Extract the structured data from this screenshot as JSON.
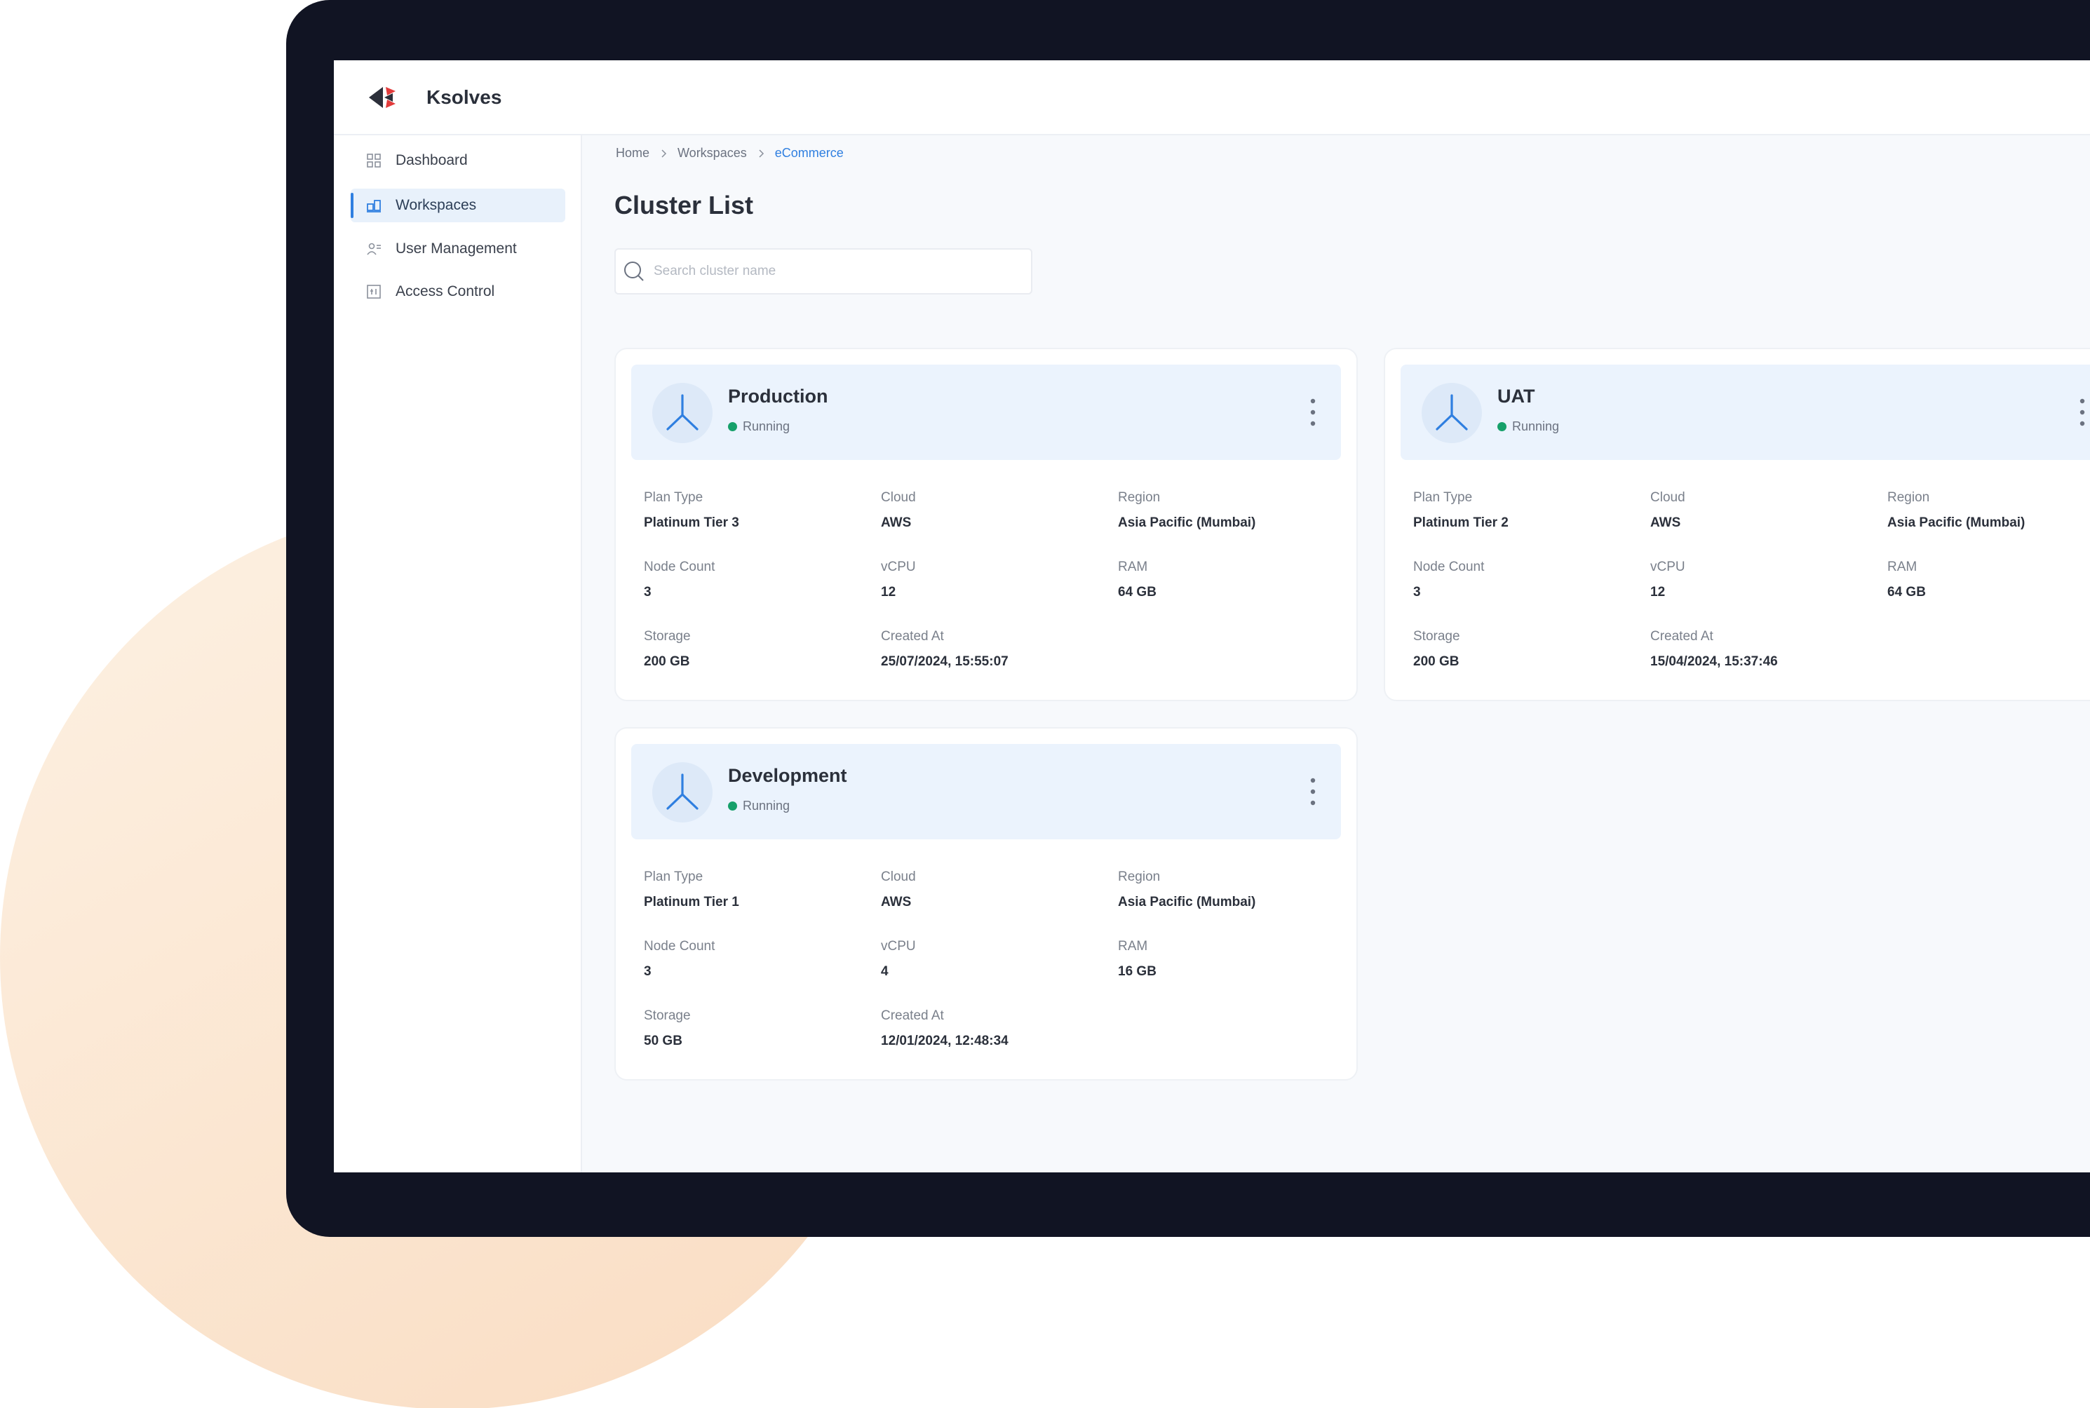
{
  "app": {
    "brand": "Ksolves"
  },
  "sidebar": {
    "items": [
      {
        "label": "Dashboard",
        "icon": "dashboard-icon",
        "active": false
      },
      {
        "label": "Workspaces",
        "icon": "workspaces-icon",
        "active": true
      },
      {
        "label": "User Management",
        "icon": "users-icon",
        "active": false
      },
      {
        "label": "Access Control",
        "icon": "access-control-icon",
        "active": false
      }
    ]
  },
  "breadcrumb": {
    "items": [
      "Home",
      "Workspaces",
      "eCommerce"
    ]
  },
  "main": {
    "title": "Cluster List",
    "search_placeholder": "Search cluster name"
  },
  "clusters": [
    {
      "name": "Production",
      "status": "Running",
      "fields": [
        {
          "label": "Plan Type",
          "value": "Platinum Tier 3"
        },
        {
          "label": "Cloud",
          "value": "AWS"
        },
        {
          "label": "Region",
          "value": "Asia Pacific (Mumbai)"
        },
        {
          "label": "Node Count",
          "value": "3"
        },
        {
          "label": "vCPU",
          "value": "12"
        },
        {
          "label": "RAM",
          "value": "64 GB"
        },
        {
          "label": "Storage",
          "value": "200 GB"
        },
        {
          "label": "Created At",
          "value": "25/07/2024, 15:55:07"
        }
      ]
    },
    {
      "name": "UAT",
      "status": "Running",
      "fields": [
        {
          "label": "Plan Type",
          "value": "Platinum Tier 2"
        },
        {
          "label": "Cloud",
          "value": "AWS"
        },
        {
          "label": "Region",
          "value": "Asia Pacific (Mumbai)"
        },
        {
          "label": "Node Count",
          "value": "3"
        },
        {
          "label": "vCPU",
          "value": "12"
        },
        {
          "label": "RAM",
          "value": "64 GB"
        },
        {
          "label": "Storage",
          "value": "200 GB"
        },
        {
          "label": "Created At",
          "value": "15/04/2024, 15:37:46"
        }
      ]
    },
    {
      "name": "Development",
      "status": "Running",
      "fields": [
        {
          "label": "Plan Type",
          "value": "Platinum Tier 1"
        },
        {
          "label": "Cloud",
          "value": "AWS"
        },
        {
          "label": "Region",
          "value": "Asia Pacific (Mumbai)"
        },
        {
          "label": "Node Count",
          "value": "3"
        },
        {
          "label": "vCPU",
          "value": "4"
        },
        {
          "label": "RAM",
          "value": "16 GB"
        },
        {
          "label": "Storage",
          "value": "50 GB"
        },
        {
          "label": "Created At",
          "value": "12/01/2024, 12:48:34"
        }
      ]
    }
  ],
  "colors": {
    "accent": "#2f7fe0",
    "status_running": "#16a06a",
    "device_frame": "#111423",
    "card_header": "#ebf3fd"
  }
}
